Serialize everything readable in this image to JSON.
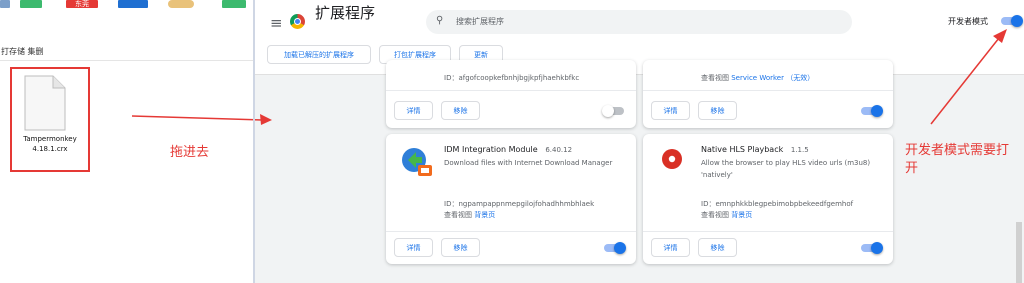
{
  "left_window": {
    "taskbar_tabs": [
      "东莞"
    ],
    "toolbar_text": "打存储 集删",
    "file": {
      "name_line1": "Tampermonkey",
      "name_line2": "4.18.1.crx"
    }
  },
  "annotations": {
    "drag_in": "拖进去",
    "dev_mode_line1": "开发者模式需要打",
    "dev_mode_line2": "开",
    "accent_color": "#e53935"
  },
  "header": {
    "menu_icon": "≡",
    "title": "扩展程序",
    "search_placeholder": "搜索扩展程序",
    "search_icon": "⚲",
    "dev_mode_label": "开发者模式",
    "dev_mode_on": true
  },
  "actions": {
    "load_unpacked": "加载已解压的扩展程序",
    "pack": "打包扩展程序",
    "update": "更新"
  },
  "cards_top": [
    {
      "id_text": "ID：afgofcoopkefbnhjbgjkpfjhaehkbfkc",
      "details": "详情",
      "remove": "移除",
      "enabled": false
    },
    {
      "inspect": "查看视图",
      "inspect_link": "Service Worker （无效）",
      "details": "详情",
      "remove": "移除",
      "enabled": true
    }
  ],
  "cards": [
    {
      "name": "IDM Integration Module",
      "version": "6.40.12",
      "desc_line1": "Download files with Internet Download Manager",
      "desc_line2": "",
      "id_text": "ID：ngpampappnmepgilojfohadhhmbhlaek",
      "inspect": "查看视图",
      "inspect_link": "背景页",
      "details": "详情",
      "remove": "移除",
      "enabled": true
    },
    {
      "name": "Native HLS Playback",
      "version": "1.1.5",
      "desc_line1": "Allow the browser to play HLS video urls (m3u8)",
      "desc_line2": "'natively'",
      "id_text": "ID：emnphkkblegpebimobpbekeedfgemhof",
      "inspect": "查看视图",
      "inspect_link": "背景页",
      "details": "详情",
      "remove": "移除",
      "enabled": true
    }
  ]
}
